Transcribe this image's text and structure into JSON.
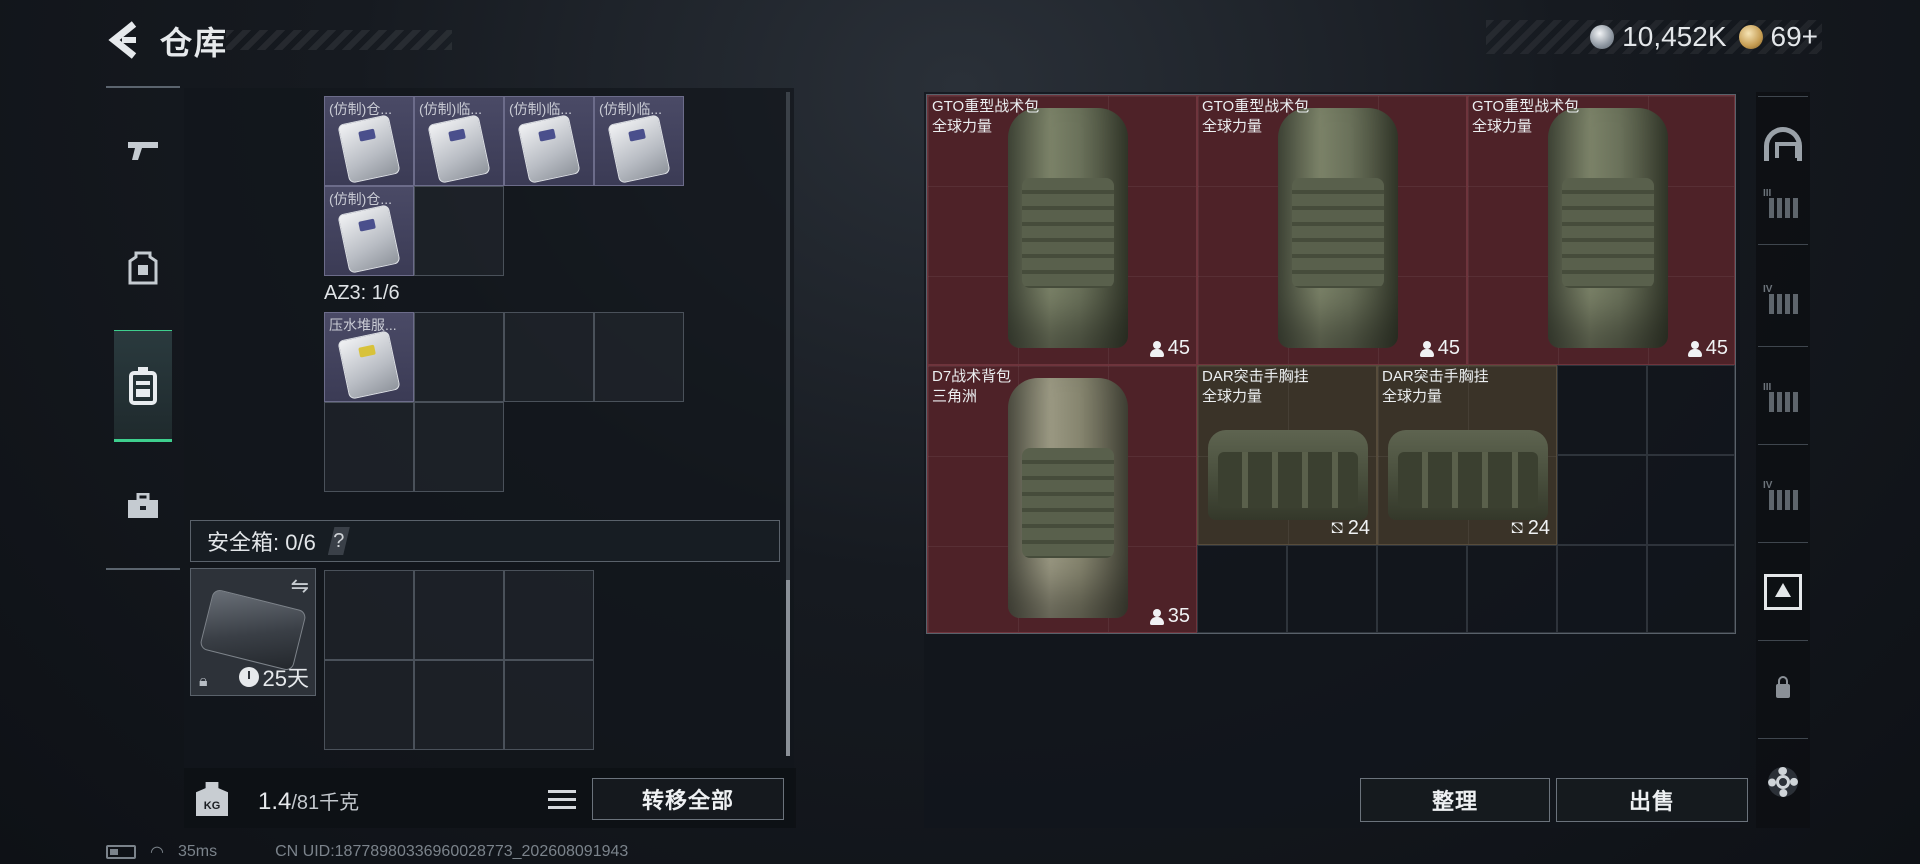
{
  "header": {
    "title": "仓库",
    "currency_silver": "10,452K",
    "currency_gold": "69+"
  },
  "left_nav": {
    "items": [
      {
        "name": "weapons",
        "icon": "pistol-icon"
      },
      {
        "name": "gear",
        "icon": "armor-icon"
      },
      {
        "name": "backpack",
        "icon": "backpack-icon",
        "active": true
      },
      {
        "name": "toolbox",
        "icon": "briefcase-icon"
      }
    ]
  },
  "container": {
    "top_items": [
      "(仿制)仓...",
      "(仿制)临...",
      "(仿制)临...",
      "(仿制)临...",
      "(仿制)仓..."
    ],
    "az3_label": "AZ3: 1/6",
    "az3_items": [
      "压水堆服..."
    ]
  },
  "safe_box": {
    "label": "安全箱: 0/6",
    "help": "?",
    "timer": "25天"
  },
  "weight": {
    "current": "1.4",
    "capacity": "/81千克",
    "kg_badge": "KG"
  },
  "buttons": {
    "transfer_all": "转移全部",
    "organize": "整理",
    "sell": "出售"
  },
  "status": {
    "ping": "35ms",
    "uid": "CN UID:18778980336960028773_202608091943"
  },
  "stash": {
    "items": [
      {
        "name": "GTO重型战术包",
        "sub": "全球力量",
        "count": "45",
        "kind": "backpack"
      },
      {
        "name": "GTO重型战术包",
        "sub": "全球力量",
        "count": "45",
        "kind": "backpack"
      },
      {
        "name": "GTO重型战术包",
        "sub": "全球力量",
        "count": "45",
        "kind": "backpack"
      },
      {
        "name": "D7战术背包",
        "sub": "三角洲",
        "count": "35",
        "kind": "backpack"
      },
      {
        "name": "DAR突击手胸挂",
        "sub": "全球力量",
        "count": "24",
        "kind": "vest"
      },
      {
        "name": "DAR突击手胸挂",
        "sub": "全球力量",
        "count": "24",
        "kind": "vest"
      }
    ]
  },
  "right_col": {
    "levels": [
      "III",
      "IV",
      "III",
      "IV"
    ]
  },
  "colors": {
    "accent_green": "#3ecf8e",
    "stash_red": "#4e2228",
    "stash_brown": "#3a3328"
  }
}
